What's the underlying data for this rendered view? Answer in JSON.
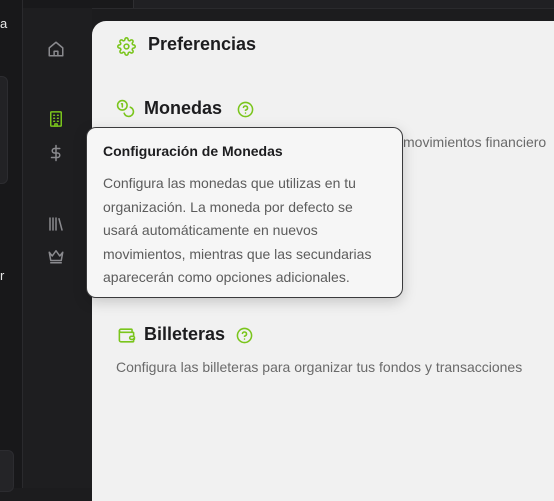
{
  "outer": {
    "text_a": "a",
    "text_r": "r"
  },
  "rail": {
    "icons": [
      "home-icon",
      "building-icon",
      "dollar-icon",
      "library-icon",
      "crown-icon"
    ],
    "accent": "#7ac51c"
  },
  "header": {
    "title": "Preferencias"
  },
  "monedas": {
    "title": "Monedas",
    "description_visible": "movimientos financiero"
  },
  "billeteras": {
    "title": "Billeteras",
    "description": "Configura las billeteras para organizar tus fondos y transacciones"
  },
  "tooltip": {
    "title": "Configuración de Monedas",
    "lines": [
      "Configura las monedas que utilizas en tu",
      "organización. La moneda por defecto se",
      "usará automáticamente en nuevos",
      "movimientos, mientras que las secundarias",
      "aparecerán como opciones adicionales."
    ]
  },
  "colors": {
    "accent": "#7ac51c",
    "panel": "#f1f1f1",
    "dark": "#1e1e20"
  }
}
